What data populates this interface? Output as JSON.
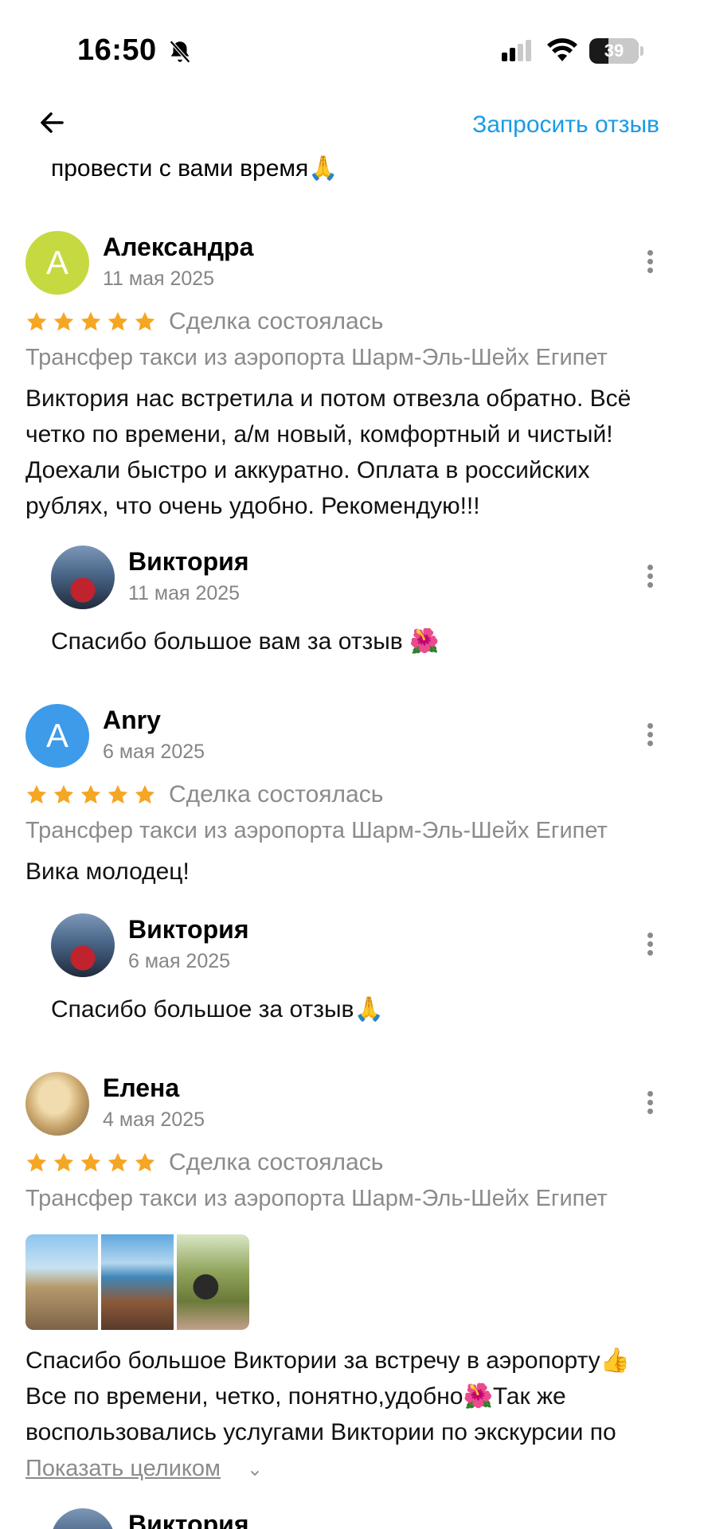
{
  "status_bar": {
    "time": "16:50",
    "battery": "39"
  },
  "top_bar": {
    "request_label": "Запросить отзыв"
  },
  "cut_text": "провести с вами время🙏",
  "reviews": [
    {
      "avatar_letter": "А",
      "avatar_color": "#c6d940",
      "name": "Александра",
      "date": "11 мая 2025",
      "rating": 5,
      "deal_status": "Сделка состоялась",
      "service": "Трансфер такси из аэропорта Шарм-Эль-Шейх Египет",
      "text": "Виктория нас встретила и потом отвезла обратно. Всё четко по времени, а/м новый, комфортный и чистый! Доехали быстро и аккуратно. Оплата в российских рублях, что очень удобно. Рекомендую!!!",
      "reply": {
        "name": "Виктория",
        "date": "11 мая 2025",
        "text": "Спасибо большое вам за отзыв 🌺"
      }
    },
    {
      "avatar_letter": "А",
      "avatar_color": "#3d9be9",
      "name": "Anry",
      "date": "6 мая 2025",
      "rating": 5,
      "deal_status": "Сделка состоялась",
      "service": "Трансфер такси из аэропорта Шарм-Эль-Шейх Египет",
      "text": "Вика молодец!",
      "reply": {
        "name": "Виктория",
        "date": "6 мая 2025",
        "text": "Спасибо большое за отзыв🙏"
      }
    },
    {
      "name": "Елена",
      "date": "4 мая 2025",
      "rating": 5,
      "deal_status": "Сделка состоялась",
      "service": "Трансфер такси из аэропорта Шарм-Эль-Шейх Египет",
      "photos_count": 3,
      "text_lines": [
        "Спасибо большое Виктории за встречу в аэропорту👍",
        "Все по времени, четко, понятно,удобно🌺Так же",
        "воспользовались услугами Виктории по экскурсии по"
      ],
      "show_more": "Показать целиком",
      "reply": {
        "name": "Виктория"
      }
    }
  ],
  "colors": {
    "accent": "#1a9be6",
    "star": "#f5a623",
    "muted": "#8b8b8b"
  }
}
